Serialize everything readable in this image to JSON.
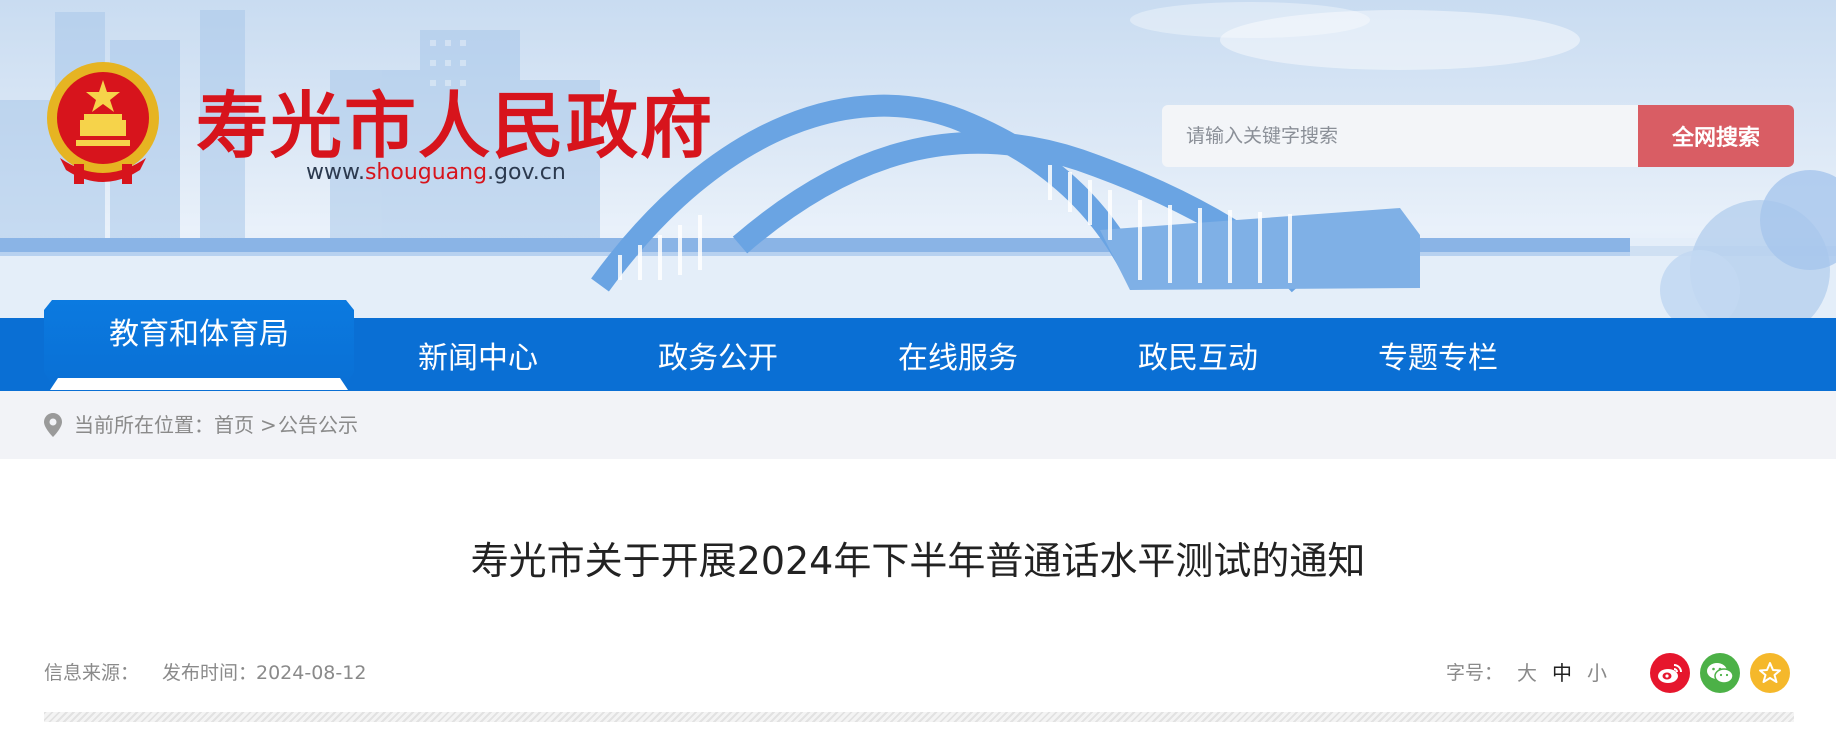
{
  "header": {
    "title": "寿光市人民政府",
    "url_prefix": "www.",
    "url_highlight": "shouguang",
    "url_suffix": ".gov.cn"
  },
  "search": {
    "placeholder": "请输入关键字搜索",
    "button_label": "全网搜索"
  },
  "nav": {
    "items": [
      {
        "label": "教育和体育局",
        "active": true
      },
      {
        "label": "新闻中心"
      },
      {
        "label": "政务公开"
      },
      {
        "label": "在线服务"
      },
      {
        "label": "政民互动"
      },
      {
        "label": "专题专栏"
      }
    ]
  },
  "breadcrumb": {
    "prefix": "当前所在位置：",
    "home": "首页",
    "separator": ">",
    "current": "公告公示"
  },
  "article": {
    "title": "寿光市关于开展2024年下半年普通话水平测试的通知",
    "source_label": "信息来源：",
    "publish_label": "发布时间：",
    "publish_date": "2024-08-12",
    "font_size_label": "字号：",
    "font_sizes": [
      "大",
      "中",
      "小"
    ],
    "active_font_size": "中"
  },
  "share": {
    "icons": [
      "weibo-icon",
      "wechat-icon",
      "favorite-star-icon"
    ],
    "colors": {
      "weibo": "#e6162d",
      "wechat": "#4cb147",
      "favorite": "#f5b82b"
    }
  },
  "colors": {
    "title_red": "#d7141c",
    "nav_blue": "#0a6fd4",
    "search_button": "#d95d64"
  }
}
